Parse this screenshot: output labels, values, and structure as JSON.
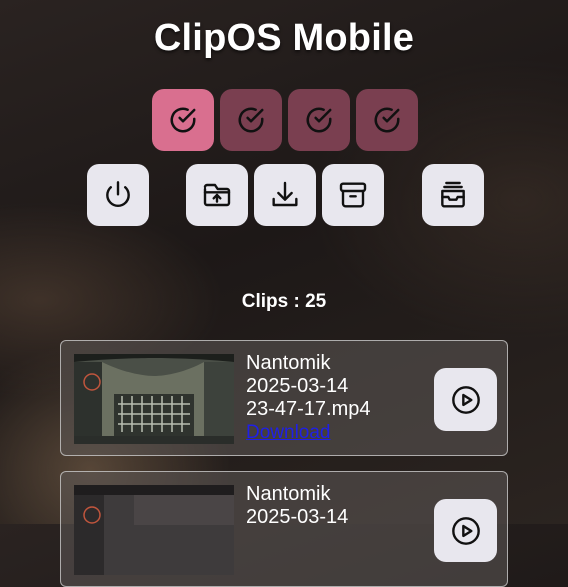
{
  "app": {
    "title": "ClipOS Mobile"
  },
  "toggles": [
    {
      "name": "toggle-1",
      "active": true
    },
    {
      "name": "toggle-2",
      "active": false
    },
    {
      "name": "toggle-3",
      "active": false
    },
    {
      "name": "toggle-4",
      "active": false
    }
  ],
  "actions": [
    {
      "name": "power-button",
      "icon": "power-icon"
    },
    {
      "name": "upload-folder-button",
      "icon": "folder-upload-icon"
    },
    {
      "name": "download-button",
      "icon": "download-icon"
    },
    {
      "name": "archive-button",
      "icon": "archive-icon"
    },
    {
      "name": "inbox-button",
      "icon": "inbox-stack-icon"
    }
  ],
  "clips": {
    "label": "Clips : 25",
    "items": [
      {
        "title": "Nantomik",
        "date": "2025-03-14",
        "file": "23-47-17.mp4",
        "download_label": "Download"
      },
      {
        "title": "Nantomik",
        "date": "2025-03-14",
        "file": "",
        "download_label": ""
      }
    ]
  },
  "colors": {
    "toggle_active": "#d96f8f",
    "toggle_inactive": "#7a3f50",
    "button_bg": "#e8e7ee",
    "link": "#1f1fe8"
  }
}
